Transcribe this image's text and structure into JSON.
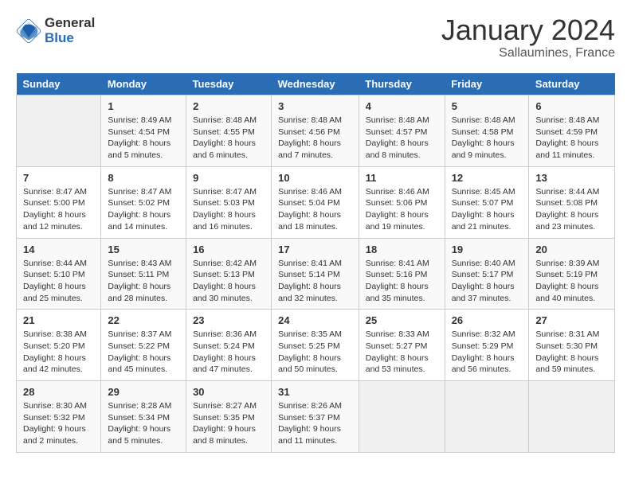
{
  "header": {
    "logo_line1": "General",
    "logo_line2": "Blue",
    "month": "January 2024",
    "location": "Sallaumines, France"
  },
  "weekdays": [
    "Sunday",
    "Monday",
    "Tuesday",
    "Wednesday",
    "Thursday",
    "Friday",
    "Saturday"
  ],
  "weeks": [
    [
      {
        "day": "",
        "info": ""
      },
      {
        "day": "1",
        "info": "Sunrise: 8:49 AM\nSunset: 4:54 PM\nDaylight: 8 hours\nand 5 minutes."
      },
      {
        "day": "2",
        "info": "Sunrise: 8:48 AM\nSunset: 4:55 PM\nDaylight: 8 hours\nand 6 minutes."
      },
      {
        "day": "3",
        "info": "Sunrise: 8:48 AM\nSunset: 4:56 PM\nDaylight: 8 hours\nand 7 minutes."
      },
      {
        "day": "4",
        "info": "Sunrise: 8:48 AM\nSunset: 4:57 PM\nDaylight: 8 hours\nand 8 minutes."
      },
      {
        "day": "5",
        "info": "Sunrise: 8:48 AM\nSunset: 4:58 PM\nDaylight: 8 hours\nand 9 minutes."
      },
      {
        "day": "6",
        "info": "Sunrise: 8:48 AM\nSunset: 4:59 PM\nDaylight: 8 hours\nand 11 minutes."
      }
    ],
    [
      {
        "day": "7",
        "info": "Sunrise: 8:47 AM\nSunset: 5:00 PM\nDaylight: 8 hours\nand 12 minutes."
      },
      {
        "day": "8",
        "info": "Sunrise: 8:47 AM\nSunset: 5:02 PM\nDaylight: 8 hours\nand 14 minutes."
      },
      {
        "day": "9",
        "info": "Sunrise: 8:47 AM\nSunset: 5:03 PM\nDaylight: 8 hours\nand 16 minutes."
      },
      {
        "day": "10",
        "info": "Sunrise: 8:46 AM\nSunset: 5:04 PM\nDaylight: 8 hours\nand 18 minutes."
      },
      {
        "day": "11",
        "info": "Sunrise: 8:46 AM\nSunset: 5:06 PM\nDaylight: 8 hours\nand 19 minutes."
      },
      {
        "day": "12",
        "info": "Sunrise: 8:45 AM\nSunset: 5:07 PM\nDaylight: 8 hours\nand 21 minutes."
      },
      {
        "day": "13",
        "info": "Sunrise: 8:44 AM\nSunset: 5:08 PM\nDaylight: 8 hours\nand 23 minutes."
      }
    ],
    [
      {
        "day": "14",
        "info": "Sunrise: 8:44 AM\nSunset: 5:10 PM\nDaylight: 8 hours\nand 25 minutes."
      },
      {
        "day": "15",
        "info": "Sunrise: 8:43 AM\nSunset: 5:11 PM\nDaylight: 8 hours\nand 28 minutes."
      },
      {
        "day": "16",
        "info": "Sunrise: 8:42 AM\nSunset: 5:13 PM\nDaylight: 8 hours\nand 30 minutes."
      },
      {
        "day": "17",
        "info": "Sunrise: 8:41 AM\nSunset: 5:14 PM\nDaylight: 8 hours\nand 32 minutes."
      },
      {
        "day": "18",
        "info": "Sunrise: 8:41 AM\nSunset: 5:16 PM\nDaylight: 8 hours\nand 35 minutes."
      },
      {
        "day": "19",
        "info": "Sunrise: 8:40 AM\nSunset: 5:17 PM\nDaylight: 8 hours\nand 37 minutes."
      },
      {
        "day": "20",
        "info": "Sunrise: 8:39 AM\nSunset: 5:19 PM\nDaylight: 8 hours\nand 40 minutes."
      }
    ],
    [
      {
        "day": "21",
        "info": "Sunrise: 8:38 AM\nSunset: 5:20 PM\nDaylight: 8 hours\nand 42 minutes."
      },
      {
        "day": "22",
        "info": "Sunrise: 8:37 AM\nSunset: 5:22 PM\nDaylight: 8 hours\nand 45 minutes."
      },
      {
        "day": "23",
        "info": "Sunrise: 8:36 AM\nSunset: 5:24 PM\nDaylight: 8 hours\nand 47 minutes."
      },
      {
        "day": "24",
        "info": "Sunrise: 8:35 AM\nSunset: 5:25 PM\nDaylight: 8 hours\nand 50 minutes."
      },
      {
        "day": "25",
        "info": "Sunrise: 8:33 AM\nSunset: 5:27 PM\nDaylight: 8 hours\nand 53 minutes."
      },
      {
        "day": "26",
        "info": "Sunrise: 8:32 AM\nSunset: 5:29 PM\nDaylight: 8 hours\nand 56 minutes."
      },
      {
        "day": "27",
        "info": "Sunrise: 8:31 AM\nSunset: 5:30 PM\nDaylight: 8 hours\nand 59 minutes."
      }
    ],
    [
      {
        "day": "28",
        "info": "Sunrise: 8:30 AM\nSunset: 5:32 PM\nDaylight: 9 hours\nand 2 minutes."
      },
      {
        "day": "29",
        "info": "Sunrise: 8:28 AM\nSunset: 5:34 PM\nDaylight: 9 hours\nand 5 minutes."
      },
      {
        "day": "30",
        "info": "Sunrise: 8:27 AM\nSunset: 5:35 PM\nDaylight: 9 hours\nand 8 minutes."
      },
      {
        "day": "31",
        "info": "Sunrise: 8:26 AM\nSunset: 5:37 PM\nDaylight: 9 hours\nand 11 minutes."
      },
      {
        "day": "",
        "info": ""
      },
      {
        "day": "",
        "info": ""
      },
      {
        "day": "",
        "info": ""
      }
    ]
  ]
}
